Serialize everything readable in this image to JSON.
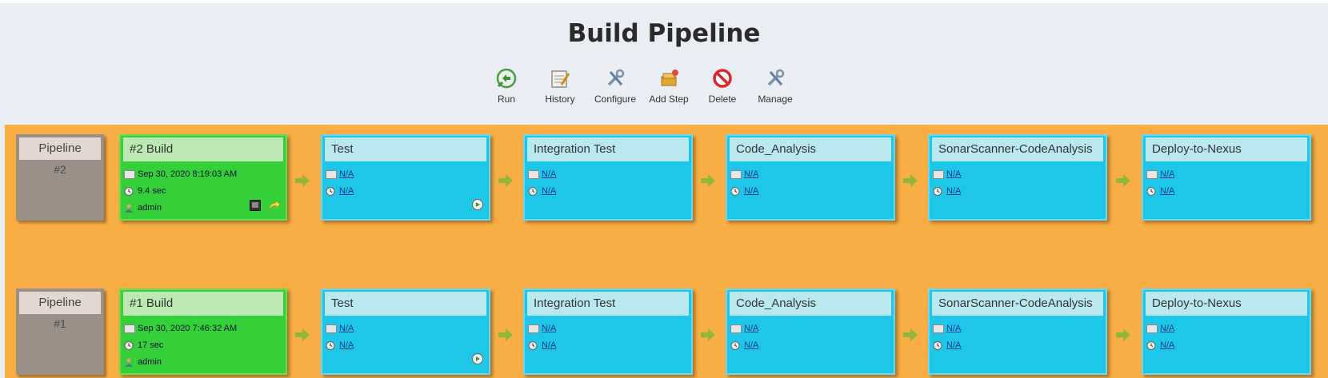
{
  "title": "Build Pipeline",
  "toolbar": [
    {
      "label": "Run",
      "icon": "run-icon"
    },
    {
      "label": "History",
      "icon": "history-icon"
    },
    {
      "label": "Configure",
      "icon": "configure-icon"
    },
    {
      "label": "Add Step",
      "icon": "add-step-icon"
    },
    {
      "label": "Delete",
      "icon": "delete-icon"
    },
    {
      "label": "Manage",
      "icon": "manage-icon"
    }
  ],
  "pipelines": [
    {
      "label": "Pipeline",
      "number": "#2",
      "build": {
        "title": "#2 Build",
        "date": "Sep 30, 2020 8:19:03 AM",
        "duration": "9.4 sec",
        "user": "admin"
      },
      "stages": [
        {
          "name": "Test",
          "date": "N/A",
          "duration": "N/A"
        },
        {
          "name": "Integration Test",
          "date": "N/A",
          "duration": "N/A"
        },
        {
          "name": "Code_Analysis",
          "date": "N/A",
          "duration": "N/A"
        },
        {
          "name": "SonarScanner-CodeAnalysis",
          "date": "N/A",
          "duration": "N/A"
        },
        {
          "name": "Deploy-to-Nexus",
          "date": "N/A",
          "duration": "N/A"
        }
      ]
    },
    {
      "label": "Pipeline",
      "number": "#1",
      "build": {
        "title": "#1 Build",
        "date": "Sep 30, 2020 7:46:32 AM",
        "duration": "17 sec",
        "user": "admin"
      },
      "stages": [
        {
          "name": "Test",
          "date": "N/A",
          "duration": "N/A"
        },
        {
          "name": "Integration Test",
          "date": "N/A",
          "duration": "N/A"
        },
        {
          "name": "Code_Analysis",
          "date": "N/A",
          "duration": "N/A"
        },
        {
          "name": "SonarScanner-CodeAnalysis",
          "date": "N/A",
          "duration": "N/A"
        },
        {
          "name": "Deploy-to-Nexus",
          "date": "N/A",
          "duration": "N/A"
        }
      ]
    }
  ],
  "colors": {
    "background": "#eaeef4",
    "pipeline_area": "#f8ae44",
    "success": "#35cf3a",
    "pending": "#1ec6e8",
    "pipeline_cell": "#9b9088"
  }
}
